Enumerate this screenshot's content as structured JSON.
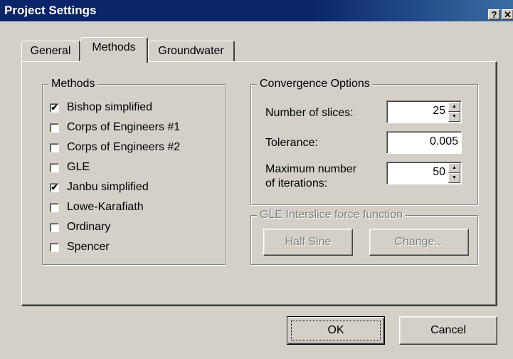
{
  "window": {
    "title": "Project Settings",
    "help_label": "?",
    "close_label": "✕"
  },
  "tabs": [
    {
      "label": "General"
    },
    {
      "label": "Methods"
    },
    {
      "label": "Groundwater"
    }
  ],
  "methods_group": {
    "title": "Methods",
    "items": [
      {
        "label": "Bishop simplified",
        "checked": true,
        "mark": "✔"
      },
      {
        "label": "Corps of Engineers #1",
        "checked": false,
        "mark": ""
      },
      {
        "label": "Corps of Engineers #2",
        "checked": false,
        "mark": ""
      },
      {
        "label": "GLE",
        "checked": false,
        "mark": ""
      },
      {
        "label": "Janbu simplified",
        "checked": true,
        "mark": "✔"
      },
      {
        "label": "Lowe-Karafiath",
        "checked": false,
        "mark": ""
      },
      {
        "label": "Ordinary",
        "checked": false,
        "mark": ""
      },
      {
        "label": "Spencer",
        "checked": false,
        "mark": ""
      }
    ]
  },
  "convergence": {
    "title": "Convergence Options",
    "slices_label": "Number of slices:",
    "slices_value": "25",
    "tolerance_label": "Tolerance:",
    "tolerance_value": "0.005",
    "iterations_label_1": "Maximum number",
    "iterations_label_2": "of iterations:",
    "iterations_value": "50",
    "spin_up": "▲",
    "spin_down": "▼"
  },
  "gle": {
    "title": "GLE Interslice force function",
    "function_button": "Half Sine",
    "change_button": "Change..."
  },
  "buttons": {
    "ok": "OK",
    "cancel": "Cancel"
  }
}
